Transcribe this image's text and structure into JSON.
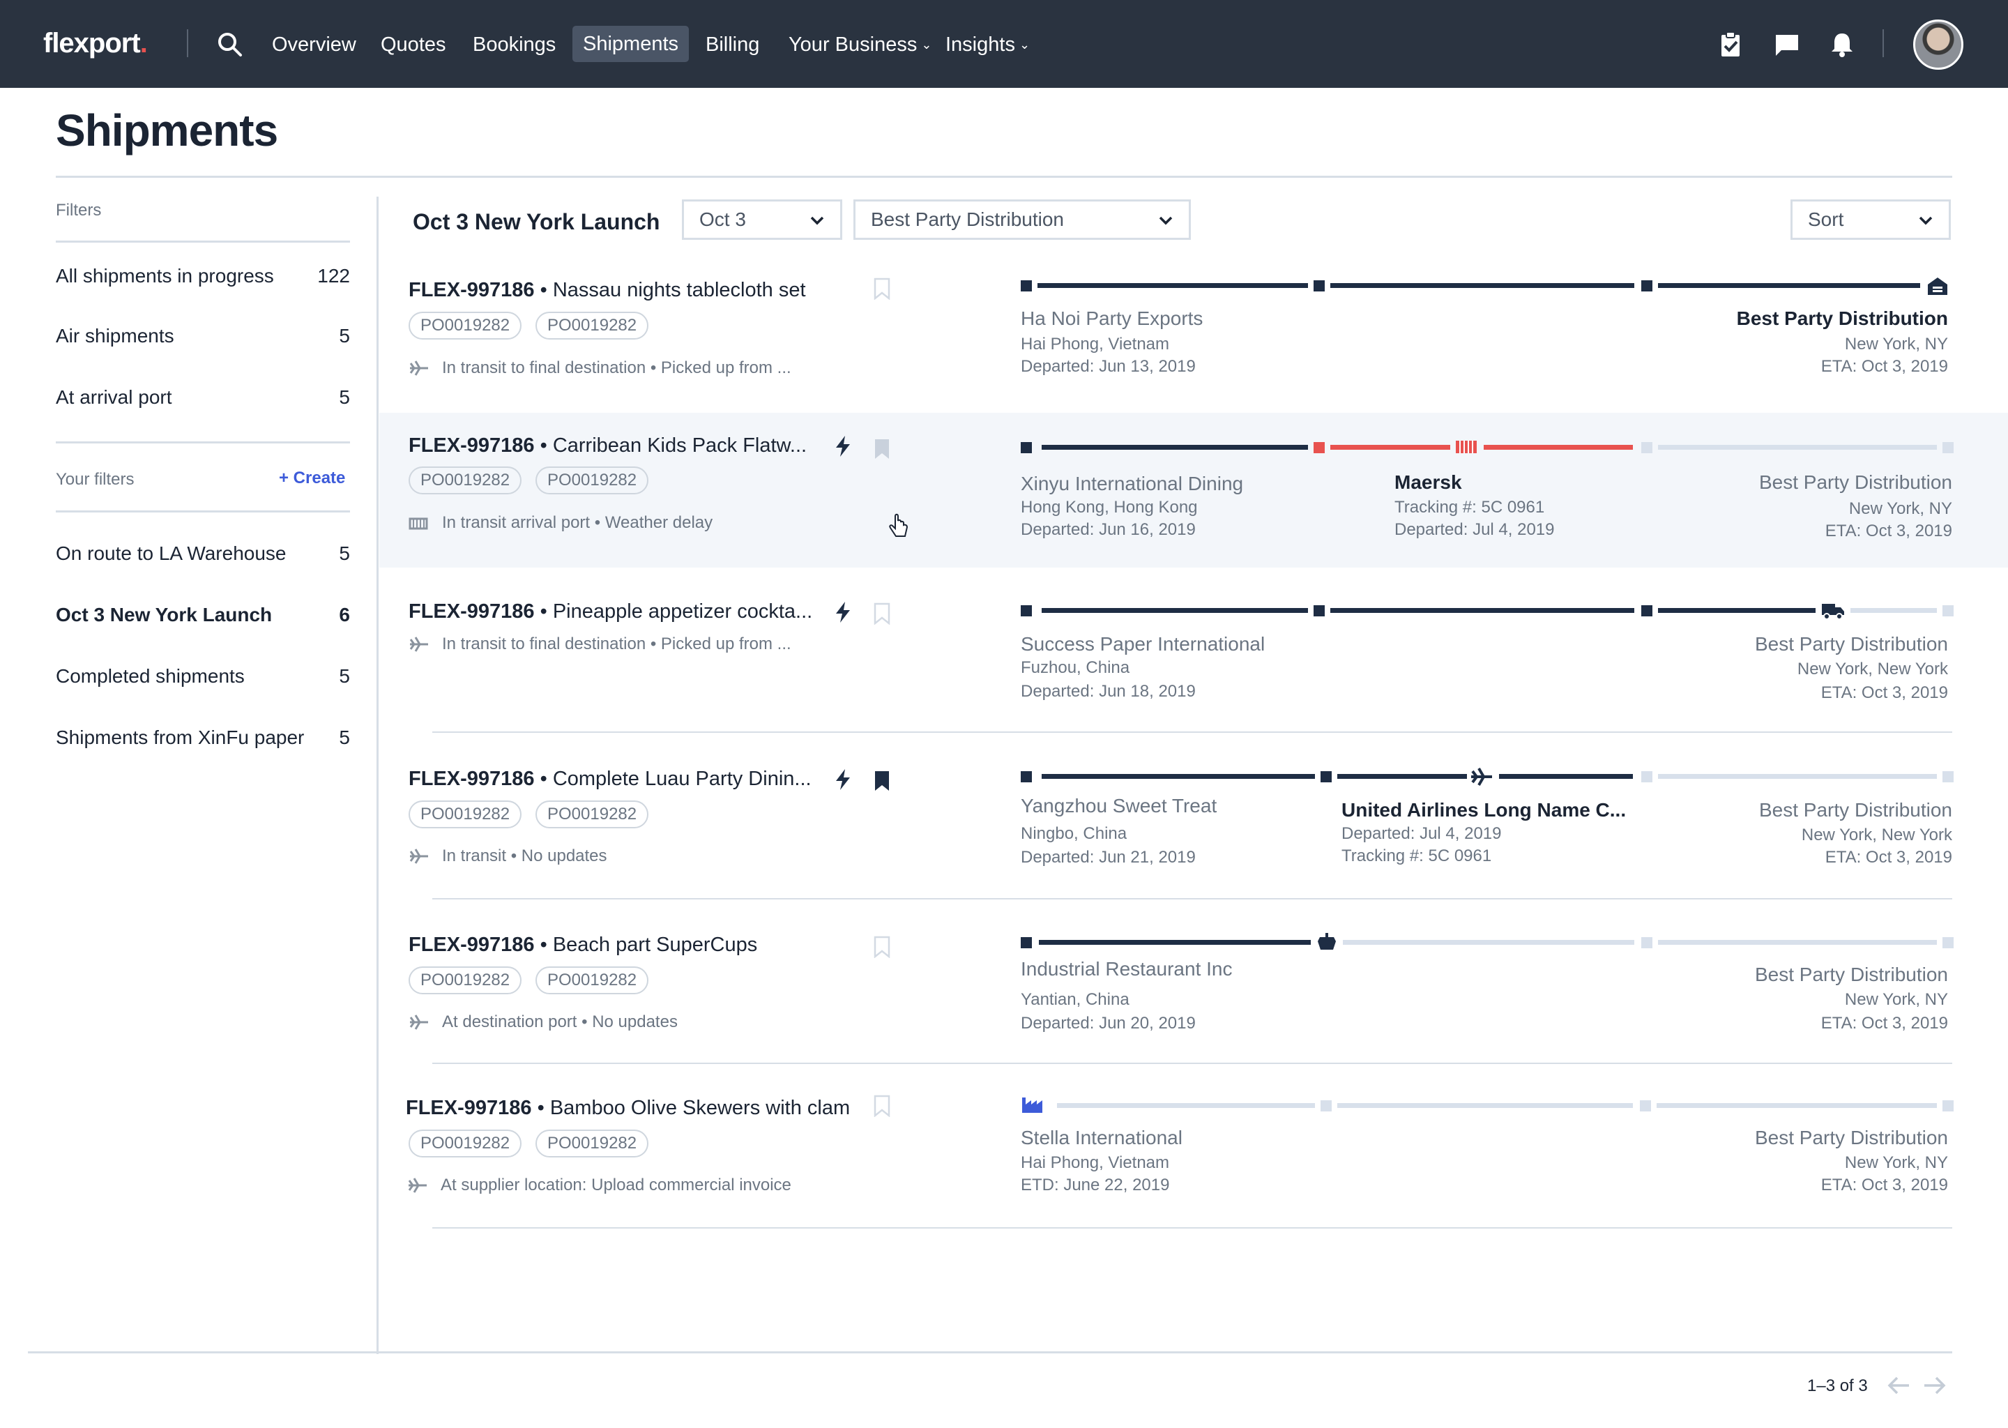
{
  "nav": {
    "logo": "flexport",
    "logo_dot": ".",
    "items": [
      "Overview",
      "Quotes",
      "Bookings",
      "Shipments",
      "Billing",
      "Your Business",
      "Insights"
    ],
    "active": "Shipments"
  },
  "page": {
    "title": "Shipments"
  },
  "sidebar": {
    "filters_label": "Filters",
    "items": [
      {
        "label": "All shipments in progress",
        "count": "122"
      },
      {
        "label": "Air shipments",
        "count": "5"
      },
      {
        "label": "At arrival port",
        "count": "5"
      }
    ],
    "your_filters_label": "Your filters",
    "create_label": "+ Create",
    "saved": [
      {
        "label": "On route to LA Warehouse",
        "count": "5"
      },
      {
        "label": "Oct 3 New York Launch",
        "count": "6"
      },
      {
        "label": "Completed shipments",
        "count": "5"
      },
      {
        "label": "Shipments from XinFu paper",
        "count": "5"
      }
    ],
    "active": "Oct 3 New York Launch"
  },
  "list": {
    "title": "Oct 3 New York Launch",
    "date_filter": "Oct 3",
    "destination_filter": "Best Party Distribution",
    "sort_label": "Sort"
  },
  "rows": [
    {
      "id": "FLEX-997186",
      "name": "• Nassau nights tablecloth set",
      "pos": [
        "PO0019282",
        "PO0019282"
      ],
      "status": "In transit to final destination • Picked up from ...",
      "origin": {
        "name": "Ha Noi Party Exports",
        "location": "Hai Phong, Vietnam",
        "date": "Departed: Jun 13, 2019"
      },
      "dest": {
        "name": "Best Party Distribution",
        "location": "New York, NY",
        "eta": "ETA: Oct 3, 2019"
      }
    },
    {
      "id": "FLEX-997186",
      "name": "• Carribean Kids Pack Flatw...",
      "pos": [
        "PO0019282",
        "PO0019282"
      ],
      "status": "In transit arrival port • Weather delay",
      "origin": {
        "name": "Xinyu International Dining",
        "location": "Hong Kong, Hong Kong",
        "date": "Departed: Jun 16, 2019"
      },
      "carrier": {
        "name": "Maersk",
        "line1": "Tracking #: 5C 0961",
        "line2": "Departed: Jul 4, 2019"
      },
      "dest": {
        "name": "Best Party Distribution",
        "location": "New York, NY",
        "eta": "ETA: Oct 3, 2019"
      }
    },
    {
      "id": "FLEX-997186",
      "name": "• Pineapple appetizer cockta...",
      "pos": [],
      "status": "In transit to final destination • Picked up from ...",
      "origin": {
        "name": "Success Paper International",
        "location": "Fuzhou, China",
        "date": "Departed: Jun 18, 2019"
      },
      "dest": {
        "name": "Best Party Distribution",
        "location": "New York, New York",
        "eta": "ETA: Oct 3, 2019"
      }
    },
    {
      "id": "FLEX-997186",
      "name": "• Complete Luau Party Dinin...",
      "pos": [
        "PO0019282",
        "PO0019282"
      ],
      "status": "In transit • No updates",
      "origin": {
        "name": "Yangzhou Sweet Treat",
        "location": "Ningbo, China",
        "date": "Departed: Jun 21, 2019"
      },
      "carrier": {
        "name": "United Airlines Long Name C...",
        "line1": "Departed: Jul 4, 2019",
        "line2": "Tracking #: 5C 0961"
      },
      "dest": {
        "name": "Best Party Distribution",
        "location": "New York, New York",
        "eta": "ETA: Oct 3, 2019"
      }
    },
    {
      "id": "FLEX-997186",
      "name": "• Beach part SuperCups",
      "pos": [
        "PO0019282",
        "PO0019282"
      ],
      "status": "At destination port • No updates",
      "origin": {
        "name": "Industrial Restaurant Inc",
        "location": "Yantian, China",
        "date": "Departed: Jun 20, 2019"
      },
      "dest": {
        "name": "Best Party Distribution",
        "location": "New York, NY",
        "eta": "ETA: Oct 3, 2019"
      }
    },
    {
      "id": "FLEX-997186",
      "name": "• Bamboo Olive Skewers with clam",
      "pos": [
        "PO0019282",
        "PO0019282"
      ],
      "status": "At supplier location: Upload commercial invoice",
      "origin": {
        "name": "Stella International",
        "location": "Hai Phong, Vietnam",
        "date": "ETD: June 22, 2019"
      },
      "dest": {
        "name": "Best Party Distribution",
        "location": "New York, NY",
        "eta": "ETA: Oct 3, 2019"
      }
    }
  ],
  "pagination": {
    "label": "1–3 of 3"
  },
  "colors": {
    "nav_bg": "#2a3340",
    "accent_blue": "#3d5bd9",
    "alert_red": "#e8524f",
    "track_dark": "#1e2d44",
    "track_light": "#d8e0eb"
  },
  "icons": [
    "search-icon",
    "tasks-icon",
    "chat-icon",
    "bell-icon",
    "bookmark-icon",
    "bolt-icon",
    "plane-icon",
    "ship-icon",
    "truck-icon",
    "factory-icon",
    "warehouse-icon",
    "prev-arrow-icon",
    "next-arrow-icon"
  ]
}
